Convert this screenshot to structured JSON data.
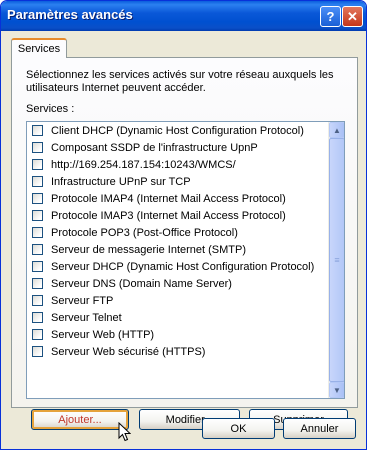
{
  "window": {
    "title": "Paramètres avancés",
    "help_glyph": "?",
    "close_glyph": "✕"
  },
  "tabs": [
    {
      "label": "Services"
    }
  ],
  "panel": {
    "description": "Sélectionnez les services activés sur votre réseau auxquels les utilisateurs Internet peuvent accéder.",
    "services_label": "Services :",
    "services": [
      {
        "label": "Client DHCP (Dynamic Host Configuration Protocol)",
        "checked": false
      },
      {
        "label": "Composant SSDP de l'infrastructure UpnP",
        "checked": false
      },
      {
        "label": "http://169.254.187.154:10243/WMCS/",
        "checked": false
      },
      {
        "label": "Infrastructure UPnP sur TCP",
        "checked": false
      },
      {
        "label": "Protocole IMAP4 (Internet Mail Access Protocol)",
        "checked": false
      },
      {
        "label": "Protocole IMAP3 (Internet Mail Access Protocol)",
        "checked": false
      },
      {
        "label": "Protocole POP3 (Post-Office Protocol)",
        "checked": false
      },
      {
        "label": "Serveur de messagerie Internet (SMTP)",
        "checked": false
      },
      {
        "label": "Serveur DHCP (Dynamic Host Configuration Protocol)",
        "checked": false
      },
      {
        "label": "Serveur DNS (Domain Name Server)",
        "checked": false
      },
      {
        "label": "Serveur FTP",
        "checked": false
      },
      {
        "label": "Serveur Telnet",
        "checked": false
      },
      {
        "label": "Serveur Web (HTTP)",
        "checked": false
      },
      {
        "label": "Serveur Web sécurisé (HTTPS)",
        "checked": false
      }
    ],
    "buttons": {
      "add": "Ajouter...",
      "modify": "Modifier...",
      "delete": "Supprimer"
    }
  },
  "footer": {
    "ok": "OK",
    "cancel": "Annuler"
  },
  "colors": {
    "titlebar": "#0a58d8",
    "dialog_bg": "#ece9d8",
    "focus_accent": "#e5a33c",
    "add_label": "#c2372b"
  }
}
